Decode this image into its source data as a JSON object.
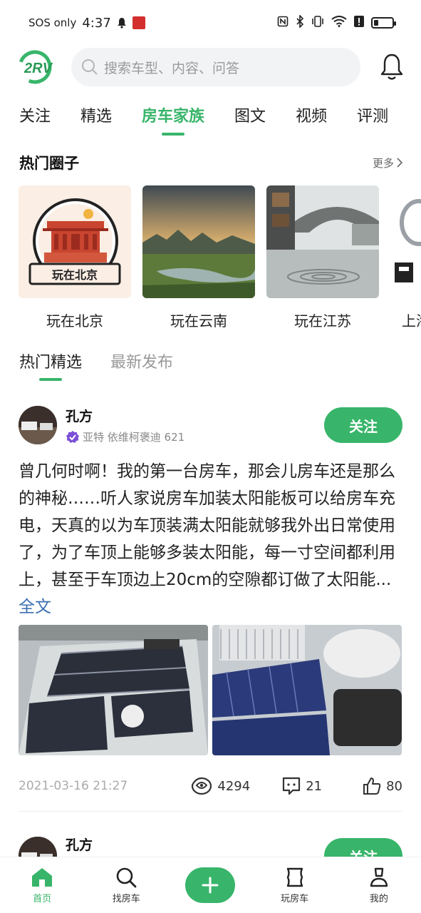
{
  "status_bar": {
    "carrier": "SOS only",
    "time": "4:37"
  },
  "header": {
    "logo_text": "2RV",
    "search_placeholder": "搜索车型、内容、问答"
  },
  "tabs": [
    {
      "label": "关注"
    },
    {
      "label": "精选"
    },
    {
      "label": "房车家族",
      "active": true
    },
    {
      "label": "图文"
    },
    {
      "label": "视频"
    },
    {
      "label": "评测"
    }
  ],
  "hot_circles": {
    "title": "热门圈子",
    "more": "更多",
    "items": [
      {
        "label": "玩在北京",
        "badge_text": "玩在北京"
      },
      {
        "label": "玩在云南"
      },
      {
        "label": "玩在江苏"
      },
      {
        "label": "上海"
      }
    ]
  },
  "sub_tabs": [
    {
      "label": "热门精选",
      "active": true
    },
    {
      "label": "最新发布"
    }
  ],
  "posts": [
    {
      "author": "孔方",
      "meta": "亚特 依维柯褒迪 621",
      "follow_label": "关注",
      "text": "曾几何时啊！我的第一台房车，那会儿房车还是那么的神秘……听人家说房车加装太阳能板可以给房车充电，天真的以为车顶装满太阳能就够我外出日常使用了，为了车顶上能够多装太阳能，每一寸空间都利用上，甚至于车顶边上20cm的空隙都订做了太阳能...",
      "more_link": "全文",
      "date": "2021-03-16 21:27",
      "views": "4294",
      "comments": "21",
      "likes": "80"
    },
    {
      "author": "孔方",
      "follow_label": "关注"
    }
  ],
  "bottom_nav": [
    {
      "label": "首页",
      "icon": "home-icon",
      "active": true
    },
    {
      "label": "找房车",
      "icon": "search-icon"
    },
    {
      "label": "",
      "icon": "plus-icon"
    },
    {
      "label": "玩房车",
      "icon": "map-icon"
    },
    {
      "label": "我的",
      "icon": "user-icon"
    }
  ],
  "colors": {
    "accent": "#38b56a",
    "link": "#3a6fb0"
  }
}
